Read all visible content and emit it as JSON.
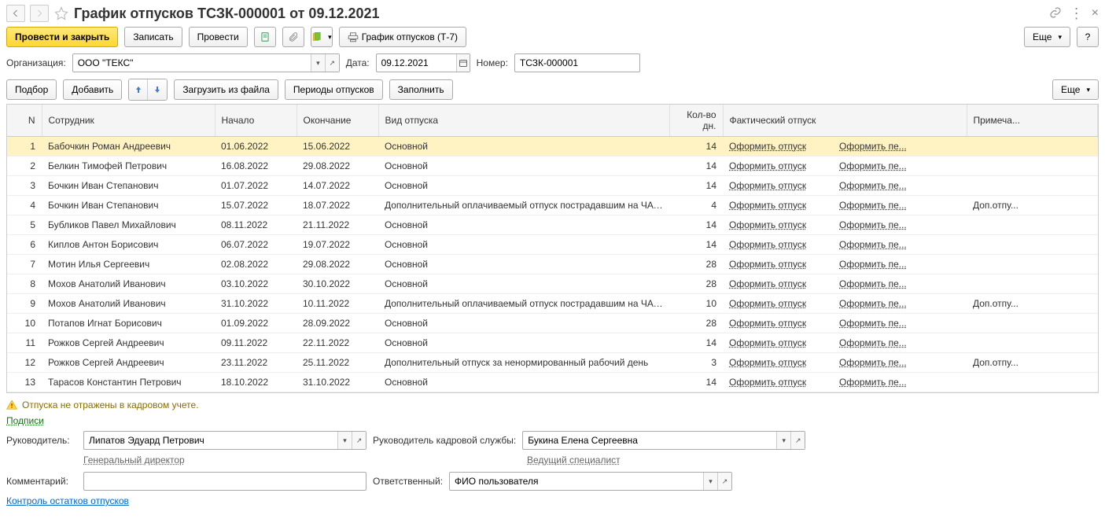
{
  "title": "График отпусков ТСЗК-000001 от 09.12.2021",
  "toolbar": {
    "post_close": "Провести и закрыть",
    "save": "Записать",
    "post": "Провести",
    "print": "График отпусков (Т-7)",
    "more": "Еще",
    "help": "?"
  },
  "form": {
    "org_label": "Организация:",
    "org_value": "ООО \"ТЕКС\"",
    "date_label": "Дата:",
    "date_value": "09.12.2021",
    "num_label": "Номер:",
    "num_value": "ТСЗК-000001"
  },
  "table_toolbar": {
    "select": "Подбор",
    "add": "Добавить",
    "load": "Загрузить из файла",
    "periods": "Периоды отпусков",
    "fill": "Заполнить",
    "more": "Еще"
  },
  "columns": {
    "n": "N",
    "employee": "Сотрудник",
    "start": "Начало",
    "end": "Окончание",
    "type": "Вид отпуска",
    "days": "Кол-во дн.",
    "fact": "Фактический отпуск",
    "note": "Примеча..."
  },
  "link_vac": "Оформить отпуск",
  "link_per": "Оформить пе...",
  "rows": [
    {
      "n": 1,
      "emp": "Бабочкин Роман Андреевич",
      "start": "01.06.2022",
      "end": "15.06.2022",
      "type": "Основной",
      "days": 14,
      "note": "",
      "sel": true
    },
    {
      "n": 2,
      "emp": "Белкин Тимофей Петрович",
      "start": "16.08.2022",
      "end": "29.08.2022",
      "type": "Основной",
      "days": 14,
      "note": ""
    },
    {
      "n": 3,
      "emp": "Бочкин Иван Степанович",
      "start": "01.07.2022",
      "end": "14.07.2022",
      "type": "Основной",
      "days": 14,
      "note": ""
    },
    {
      "n": 4,
      "emp": "Бочкин Иван Степанович",
      "start": "15.07.2022",
      "end": "18.07.2022",
      "type": "Дополнительный оплачиваемый отпуск пострадавшим на ЧАЭС",
      "days": 4,
      "note": "Доп.отпу..."
    },
    {
      "n": 5,
      "emp": "Бубликов Павел Михайлович",
      "start": "08.11.2022",
      "end": "21.11.2022",
      "type": "Основной",
      "days": 14,
      "note": ""
    },
    {
      "n": 6,
      "emp": "Киплов Антон Борисович",
      "start": "06.07.2022",
      "end": "19.07.2022",
      "type": "Основной",
      "days": 14,
      "note": ""
    },
    {
      "n": 7,
      "emp": "Мотин Илья Сергеевич",
      "start": "02.08.2022",
      "end": "29.08.2022",
      "type": "Основной",
      "days": 28,
      "note": ""
    },
    {
      "n": 8,
      "emp": "Мохов Анатолий Иванович",
      "start": "03.10.2022",
      "end": "30.10.2022",
      "type": "Основной",
      "days": 28,
      "note": ""
    },
    {
      "n": 9,
      "emp": "Мохов Анатолий Иванович",
      "start": "31.10.2022",
      "end": "10.11.2022",
      "type": "Дополнительный оплачиваемый отпуск пострадавшим на ЧАЭС",
      "days": 10,
      "note": "Доп.отпу..."
    },
    {
      "n": 10,
      "emp": "Потапов Игнат Борисович",
      "start": "01.09.2022",
      "end": "28.09.2022",
      "type": "Основной",
      "days": 28,
      "note": ""
    },
    {
      "n": 11,
      "emp": "Рожков Сергей Андреевич",
      "start": "09.11.2022",
      "end": "22.11.2022",
      "type": "Основной",
      "days": 14,
      "note": ""
    },
    {
      "n": 12,
      "emp": "Рожков Сергей Андреевич",
      "start": "23.11.2022",
      "end": "25.11.2022",
      "type": "Дополнительный отпуск за ненормированный рабочий день",
      "days": 3,
      "note": "Доп.отпу..."
    },
    {
      "n": 13,
      "emp": "Тарасов Константин Петрович",
      "start": "18.10.2022",
      "end": "31.10.2022",
      "type": "Основной",
      "days": 14,
      "note": ""
    }
  ],
  "warning": "Отпуска не отражены в кадровом учете.",
  "signatures_link": "Подписи",
  "sig": {
    "head_label": "Руководитель:",
    "head_value": "Липатов Эдуард Петрович",
    "head_pos": "Генеральный директор",
    "hr_label": "Руководитель кадровой службы:",
    "hr_value": "Букина Елена Сергеевна",
    "hr_pos": "Ведущий специалист"
  },
  "footer": {
    "comment_label": "Комментарий:",
    "comment_value": "",
    "resp_label": "Ответственный:",
    "resp_value": "ФИО пользователя",
    "control_link": "Контроль остатков отпусков"
  }
}
